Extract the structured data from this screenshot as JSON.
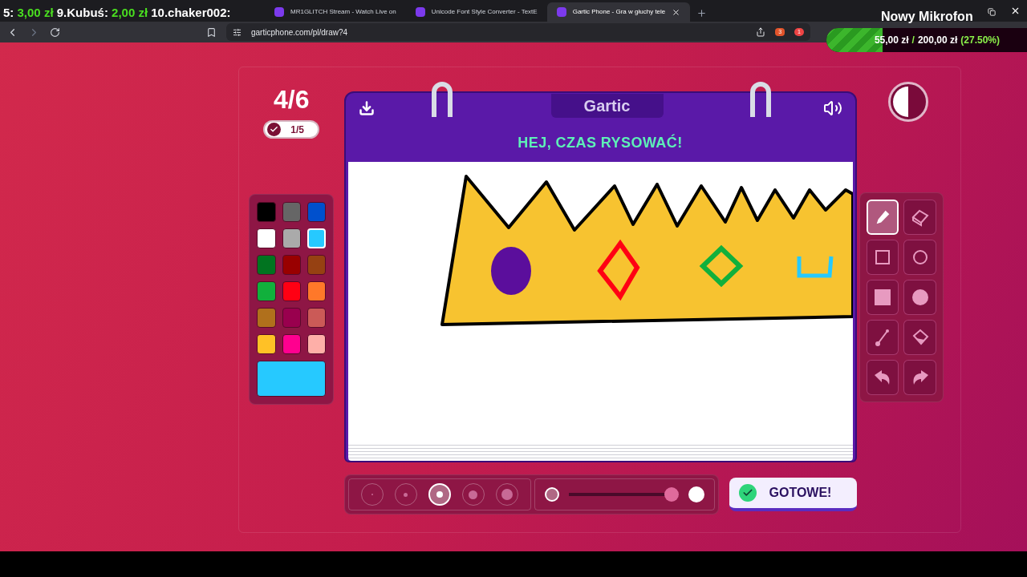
{
  "stream_overlay": {
    "ticker": "5: **3,00 zł** 9.Kubuś: **2,00 zł** 10.chaker002:",
    "title": "Nowy Mikrofon",
    "goal": {
      "current": "55,00 zł",
      "separator": "/",
      "target": "200,00 zł",
      "percent": "(27.50%)",
      "level": 0.28
    }
  },
  "browser": {
    "tabs": [
      {
        "title": "MR1GLITCH Stream - Watch Live on",
        "selected": false
      },
      {
        "title": "Unicode Font Style Converter - TextE",
        "selected": false
      },
      {
        "title": "Gartic Phone - Gra w głuchy tele",
        "selected": true
      }
    ],
    "address": "garticphone.com/pl/draw?4",
    "shield_count": "3",
    "alert_count": "1"
  },
  "game": {
    "round": "4/6",
    "done_count": "1/5",
    "logo": "Gartic",
    "title": "HEJ, CZAS RYSOWAĆ!",
    "palette": [
      {
        "color": "#000000",
        "selected": false
      },
      {
        "color": "#666666",
        "selected": false
      },
      {
        "color": "#0050cd",
        "selected": false
      },
      {
        "color": "#ffffff",
        "selected": false
      },
      {
        "color": "#aaaaaa",
        "selected": false
      },
      {
        "color": "#26c9ff",
        "selected": true
      },
      {
        "color": "#017420",
        "selected": false
      },
      {
        "color": "#990000",
        "selected": false
      },
      {
        "color": "#964112",
        "selected": false
      },
      {
        "color": "#11b03c",
        "selected": false
      },
      {
        "color": "#ff0013",
        "selected": false
      },
      {
        "color": "#ff7829",
        "selected": false
      },
      {
        "color": "#b0701c",
        "selected": false
      },
      {
        "color": "#99004e",
        "selected": false
      },
      {
        "color": "#cb5a57",
        "selected": false
      },
      {
        "color": "#ffc126",
        "selected": false
      },
      {
        "color": "#ff008f",
        "selected": false
      },
      {
        "color": "#feafa8",
        "selected": false
      }
    ],
    "tools": [
      {
        "kind": "pencil",
        "selected": true
      },
      {
        "kind": "eraser",
        "selected": false
      },
      {
        "kind": "square",
        "selected": false
      },
      {
        "kind": "circle",
        "selected": false
      },
      {
        "kind": "filled-square",
        "selected": false
      },
      {
        "kind": "filled-circle",
        "selected": false
      },
      {
        "kind": "line",
        "selected": false
      },
      {
        "kind": "bucket",
        "selected": false
      },
      {
        "kind": "undo",
        "selected": false
      },
      {
        "kind": "redo",
        "selected": false
      }
    ],
    "brush_sizes": [
      {
        "selected": false
      },
      {
        "selected": false
      },
      {
        "selected": true
      },
      {
        "selected": false
      },
      {
        "selected": false
      }
    ],
    "opacity": {
      "level": 1
    },
    "done_button": "GOTOWE!"
  }
}
